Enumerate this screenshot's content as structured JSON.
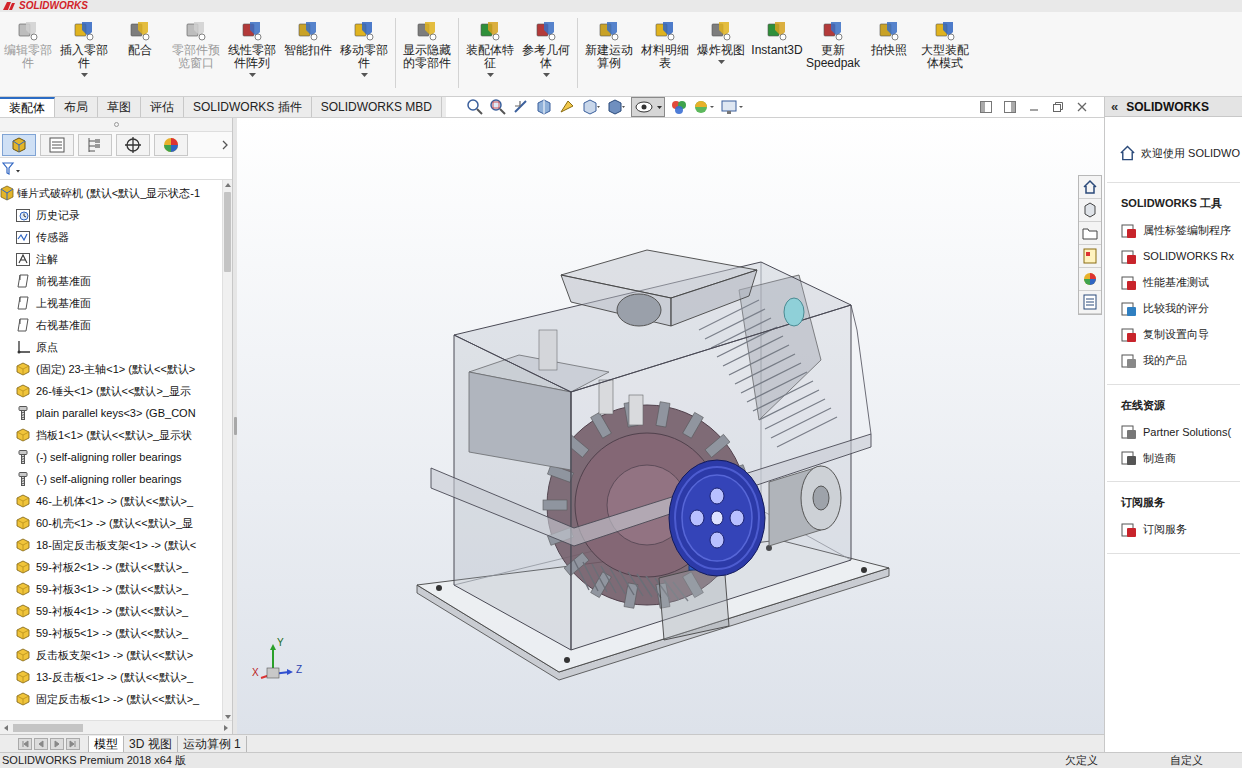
{
  "title_bar": {
    "logo": "SOLIDWORKS"
  },
  "ribbon": [
    {
      "label": "编辑零部件",
      "disabled": true,
      "dropdown": false
    },
    {
      "label": "插入零部件",
      "disabled": false,
      "dropdown": true
    },
    {
      "label": "配合",
      "disabled": false,
      "dropdown": false
    },
    {
      "label": "零部件预览窗口",
      "disabled": true,
      "dropdown": false
    },
    {
      "label": "线性零部件阵列",
      "disabled": false,
      "dropdown": true
    },
    {
      "label": "智能扣件",
      "disabled": false,
      "dropdown": false
    },
    {
      "label": "移动零部件",
      "disabled": false,
      "dropdown": true
    },
    {
      "label": "显示隐藏的零部件",
      "disabled": false,
      "dropdown": false
    },
    {
      "label": "装配体特征",
      "disabled": false,
      "dropdown": true
    },
    {
      "label": "参考几何体",
      "disabled": false,
      "dropdown": true
    },
    {
      "label": "新建运动算例",
      "disabled": false,
      "dropdown": false
    },
    {
      "label": "材料明细表",
      "disabled": false,
      "dropdown": false
    },
    {
      "label": "爆炸视图",
      "disabled": false,
      "dropdown": true
    },
    {
      "label": "Instant3D",
      "disabled": false,
      "dropdown": false
    },
    {
      "label": "更新Speedpak",
      "disabled": false,
      "dropdown": false
    },
    {
      "label": "拍快照",
      "disabled": false,
      "dropdown": false
    },
    {
      "label": "大型装配体模式",
      "disabled": false,
      "dropdown": false
    }
  ],
  "tabs": [
    {
      "label": "装配体",
      "selected": true
    },
    {
      "label": "布局",
      "selected": false
    },
    {
      "label": "草图",
      "selected": false
    },
    {
      "label": "评估",
      "selected": false
    },
    {
      "label": "SOLIDWORKS 插件",
      "selected": false
    },
    {
      "label": "SOLIDWORKS MBD",
      "selected": false
    }
  ],
  "feature_tree": {
    "root": "锤片式破碎机  (默认<默认_显示状态-1",
    "items": [
      {
        "label": "历史记录",
        "kind": "history"
      },
      {
        "label": "传感器",
        "kind": "sensor"
      },
      {
        "label": "注解",
        "kind": "annotation"
      },
      {
        "label": "前视基准面",
        "kind": "plane"
      },
      {
        "label": "上视基准面",
        "kind": "plane"
      },
      {
        "label": "右视基准面",
        "kind": "plane"
      },
      {
        "label": "原点",
        "kind": "origin"
      },
      {
        "label": "(固定) 23-主轴<1> (默认<<默认>",
        "kind": "part"
      },
      {
        "label": "26-锤头<1> (默认<<默认>_显示",
        "kind": "part"
      },
      {
        "label": "plain parallel keys<3> (GB_CON",
        "kind": "toolbox"
      },
      {
        "label": "挡板1<1> (默认<<默认>_显示状",
        "kind": "part"
      },
      {
        "label": "(-) self-aligning roller bearings",
        "kind": "toolbox"
      },
      {
        "label": "(-) self-aligning roller bearings",
        "kind": "toolbox"
      },
      {
        "label": "46-上机体<1> -> (默认<<默认>_",
        "kind": "part"
      },
      {
        "label": "60-机壳<1> -> (默认<<默认>_显",
        "kind": "part"
      },
      {
        "label": "18-固定反击板支架<1> -> (默认<",
        "kind": "part"
      },
      {
        "label": "59-衬板2<1> -> (默认<<默认>_",
        "kind": "part"
      },
      {
        "label": "59-衬板3<1> -> (默认<<默认>_",
        "kind": "part"
      },
      {
        "label": "59-衬板4<1> -> (默认<<默认>_",
        "kind": "part"
      },
      {
        "label": "59-衬板5<1> -> (默认<<默认>_",
        "kind": "part"
      },
      {
        "label": "反击板支架<1> -> (默认<<默认>",
        "kind": "part"
      },
      {
        "label": "13-反击板<1> -> (默认<<默认>_",
        "kind": "part"
      },
      {
        "label": "固定反击板<1> -> (默认<<默认>_",
        "kind": "part"
      }
    ]
  },
  "viewport": {
    "triad": {
      "x": "X",
      "y": "Y",
      "z": "Z"
    }
  },
  "task_pane": {
    "collapse": "«",
    "title": "SOLIDWORKS",
    "welcome": "欢迎使用  SOLIDWO",
    "sections": [
      {
        "title": "SOLIDWORKS 工具",
        "items": [
          "属性标签编制程序",
          "SOLIDWORKS Rx",
          "性能基准测试",
          "比较我的评分",
          "复制设置向导",
          "我的产品"
        ]
      },
      {
        "title": "在线资源",
        "items": [
          "Partner Solutions(",
          "制造商"
        ]
      },
      {
        "title": "订阅服务",
        "items": [
          "订阅服务"
        ]
      }
    ]
  },
  "bottom_tabs": [
    {
      "label": "模型",
      "selected": true
    },
    {
      "label": "3D 视图",
      "selected": false
    },
    {
      "label": "运动算例 1",
      "selected": false
    }
  ],
  "status_bar": {
    "product": "SOLIDWORKS Premium 2018 x64 版",
    "state": "欠定义",
    "units": "自定义"
  }
}
